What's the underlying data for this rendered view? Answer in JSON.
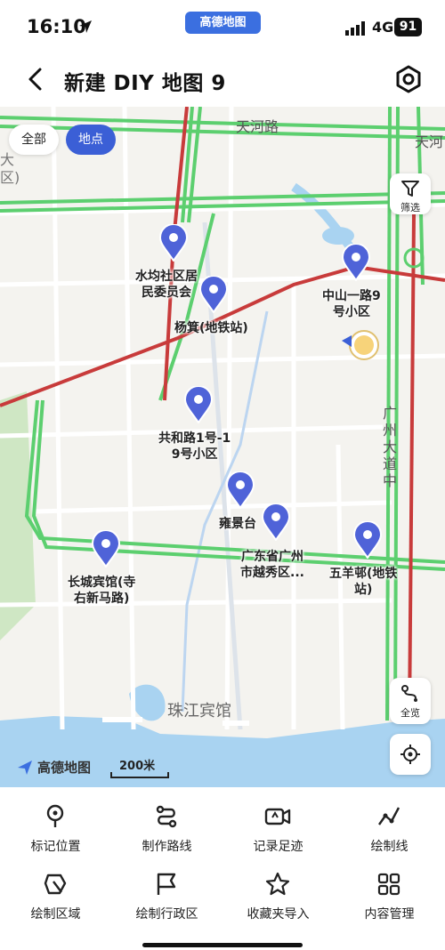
{
  "status_bar": {
    "time": "16:10",
    "app_pill": "高德地图",
    "network": "4G",
    "battery": "91"
  },
  "header": {
    "title": "新建 DIY 地图 9"
  },
  "map": {
    "segment": {
      "all": "全部",
      "points": "地点"
    },
    "filter_label": "筛选",
    "overview_label": "全览",
    "brand": "高德地图",
    "scale": "200米",
    "roads": {
      "tianhe": "天河路",
      "tianhe_right": "天河",
      "guangzhou_avenue": "广州大道中",
      "pearl_hotel": "珠江宾馆",
      "left_partial_a": "大",
      "left_partial_b": "区)"
    },
    "pins": [
      {
        "name": "水均社区居民委员会",
        "label_lines": [
          "水均社区居",
          "民委员会"
        ]
      },
      {
        "name": "杨箕(地铁站)",
        "label_lines": [
          "杨箕(地铁站)"
        ]
      },
      {
        "name": "中山一路9号小区",
        "label_lines": [
          "中山一路9",
          "号小区"
        ]
      },
      {
        "name": "共和路1号-19号小区",
        "label_lines": [
          "共和路1号-1",
          "9号小区"
        ]
      },
      {
        "name": "雍景台",
        "label_lines": [
          "雍景台"
        ]
      },
      {
        "name": "广东省广州市越秀区...",
        "label_lines": [
          "广东省广州",
          "市越秀区..."
        ]
      },
      {
        "name": "五羊邨(地铁站)",
        "label_lines": [
          "五羊邨(地铁",
          "站)"
        ]
      },
      {
        "name": "长城宾馆(寺右新马路)",
        "label_lines": [
          "长城宾馆(寺",
          "右新马路)"
        ]
      }
    ]
  },
  "tools": [
    {
      "label": "标记位置",
      "icon": "location-pin-icon"
    },
    {
      "label": "制作路线",
      "icon": "route-icon"
    },
    {
      "label": "记录足迹",
      "icon": "video-record-icon"
    },
    {
      "label": "绘制线",
      "icon": "polyline-icon"
    },
    {
      "label": "绘制区域",
      "icon": "area-icon"
    },
    {
      "label": "绘制行政区",
      "icon": "flag-icon"
    },
    {
      "label": "收藏夹导入",
      "icon": "star-icon"
    },
    {
      "label": "内容管理",
      "icon": "grid-icon"
    }
  ],
  "colors": {
    "accent": "#3b5fd6",
    "pin": "#4f63d8",
    "road_green": "#5ccf6f",
    "road_red": "#c83b3b"
  }
}
